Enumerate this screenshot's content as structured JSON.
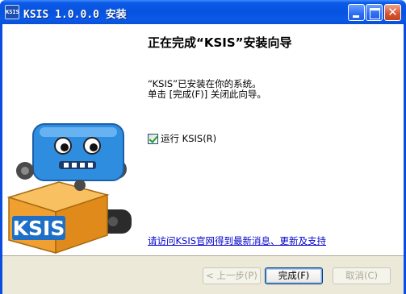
{
  "window": {
    "title": "KSIS 1.0.0.0 安装",
    "app_icon_text": "KSIS"
  },
  "titlebar_buttons": {
    "minimize": "minimize-icon",
    "maximize": "maximize-icon",
    "close_glyph": "✕"
  },
  "content": {
    "heading": "正在完成“KSIS”安装向导",
    "line1": "“KSIS”已安装在你的系统。",
    "line2": "单击 [完成(F)] 关闭此向导。",
    "run_checkbox_label": "运行 KSIS(R)",
    "run_checkbox_checked": true,
    "link_text": "请访问KSIS官网得到最新消息、更新及支持"
  },
  "artwork": {
    "box_text": "KSIS"
  },
  "buttons": {
    "back_label": "< 上一步(P)",
    "finish_label": "完成(F)",
    "cancel_label": "取消(C)"
  },
  "colors": {
    "titlebar": "#0653df",
    "robot_blue": "#2f8de0",
    "box_orange": "#f0a030",
    "box_label_blue": "#1f6ec8",
    "link": "#0000cc",
    "button_face": "#ece9d8"
  }
}
